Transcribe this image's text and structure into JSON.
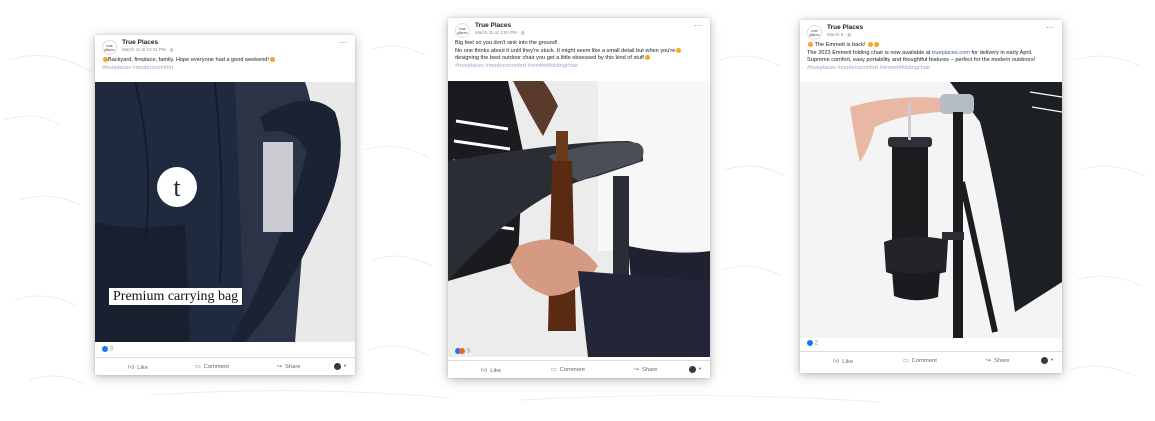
{
  "posts": [
    {
      "page_name": "True Places",
      "avatar_text": "true places",
      "date": "March 11 at 12:11 PM · ",
      "text_lines": [
        "Backyard, fireplace, family. Hope everyone had a good weekend!"
      ],
      "hashtags": "#trueplaces #moderncomfort",
      "media_caption": "Premium carrying bag",
      "reaction_count": "3",
      "actions": {
        "like": "Like",
        "comment": "Comment",
        "share": "Share"
      }
    },
    {
      "page_name": "True Places",
      "avatar_text": "true places",
      "date": "March 15 at 3:00 PM · ",
      "text_lines": [
        "Big feet so you don't sink into the ground!",
        "No one thinks about it until they're stuck. It might seem like a small detail but when you're",
        "designing the best outdoor chair you get a little obsessed by this kind of stuff"
      ],
      "hashtags": "#trueplaces #moderncomfort #emmettfoldingchair",
      "reaction_count": "3",
      "actions": {
        "like": "Like",
        "comment": "Comment",
        "share": "Share"
      }
    },
    {
      "page_name": "True Places",
      "avatar_text": "true places",
      "date": "March 8 · ",
      "text_lines_link": {
        "line1": "The Emmett is back!",
        "line2_pre": "The 2023 Emmett folding chair is now available at ",
        "line2_link": "trueplaces.com",
        "line2_post": " for delivery in early April.",
        "line3": "Supreme comfort, easy portability and thoughtful features – perfect for the modern outdoors!"
      },
      "hashtags": "#trueplaces #moderncomfort #emmettfoldingchair",
      "reaction_count": "2",
      "actions": {
        "like": "Like",
        "comment": "Comment",
        "share": "Share"
      }
    }
  ],
  "icons": {
    "more": "more-options-icon",
    "like": "thumbs-up-icon",
    "comment": "comment-icon",
    "share": "share-icon",
    "reaction": "like-reaction-icon"
  },
  "colors": {
    "facebook_blue": "#1877f2",
    "link": "#385898",
    "hashtag": "#9aa9c7",
    "meta_gray": "#606770"
  }
}
